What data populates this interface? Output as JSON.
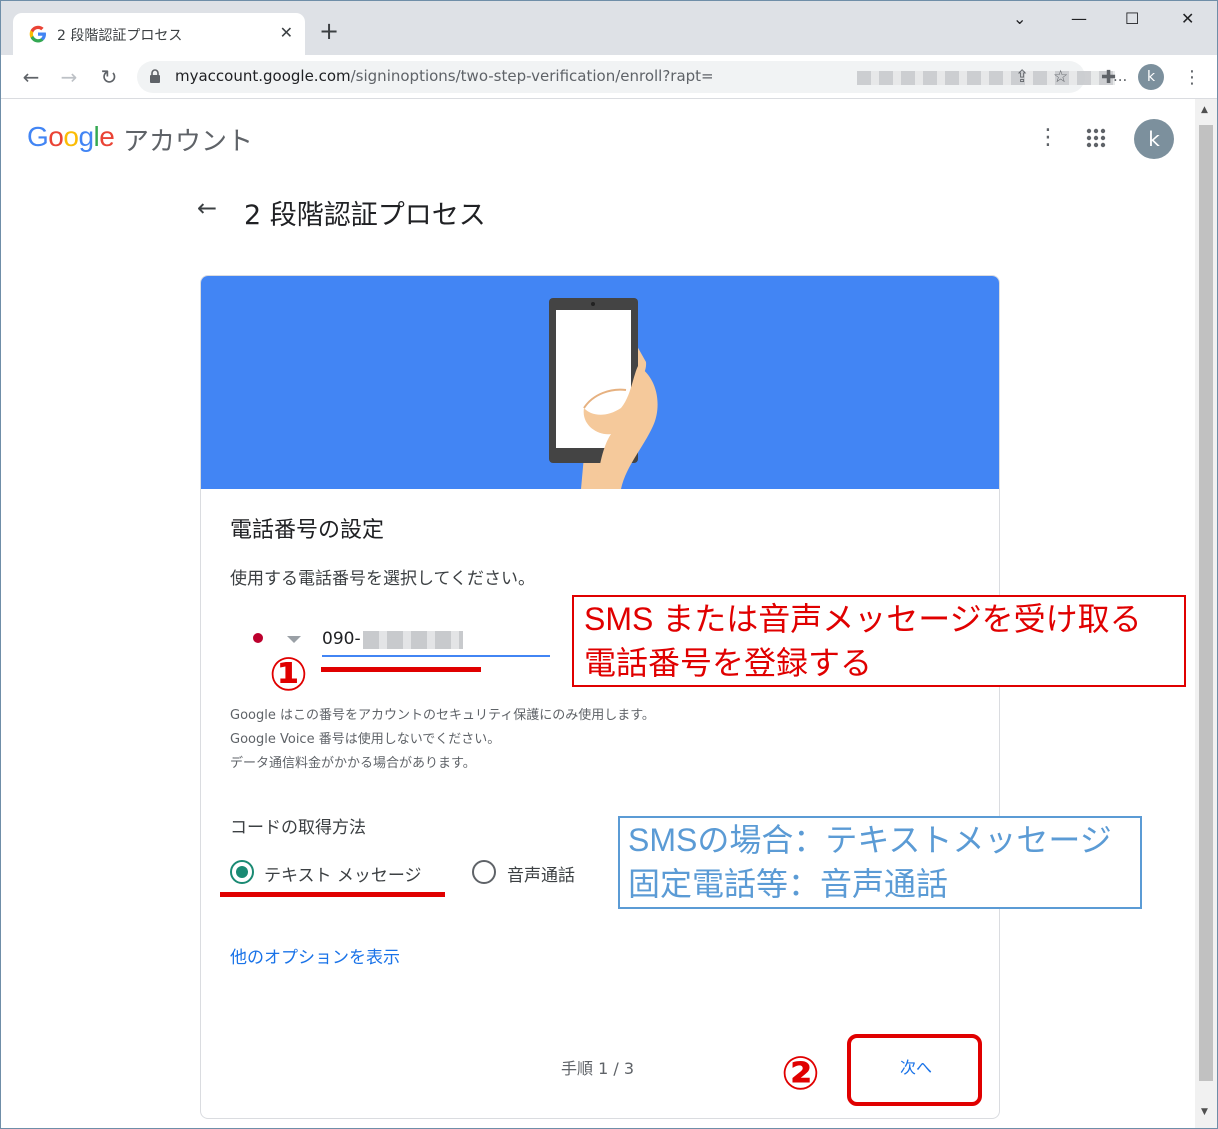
{
  "browser": {
    "tab_title": "2 段階認証プロセス",
    "tab_close": "✕",
    "new_tab": "+",
    "url_host": "myaccount.google.com",
    "url_path": "/signinoptions/two-step-verification/enroll?rapt=",
    "url_ellipsis": "...",
    "avatar_letter": "k",
    "controls": {
      "minimize": "—",
      "maximize": "☐",
      "close": "✕",
      "menu": "⌄"
    }
  },
  "header": {
    "logo_text": [
      "G",
      "o",
      "o",
      "g",
      "l",
      "e"
    ],
    "logo_colors": [
      "#4285f4",
      "#ea4335",
      "#fbbc05",
      "#4285f4",
      "#34a853",
      "#ea4335"
    ],
    "account_label": "アカウント",
    "avatar_letter": "k"
  },
  "page": {
    "title": "2 段階認証プロセス",
    "card": {
      "heading": "電話番号の設定",
      "instruction": "使用する電話番号を選択してください。",
      "phone_prefix": "090-",
      "help_lines": [
        "Google はこの番号をアカウントのセキュリティ保護にのみ使用します。",
        "Google Voice 番号は使用しないでください。",
        "データ通信料金がかかる場合があります。"
      ],
      "method_label": "コードの取得方法",
      "method_options": [
        {
          "label": "テキスト メッセージ",
          "selected": true
        },
        {
          "label": "音声通話",
          "selected": false
        }
      ],
      "more_options": "他のオプションを表示",
      "step": "手順 1 / 3",
      "next": "次へ"
    }
  },
  "annotations": {
    "marker1": "①",
    "marker2": "②",
    "red_note": [
      "SMS または音声メッセージを受け取る",
      "電話番号を登録する"
    ],
    "blue_note": [
      "SMSの場合：テキストメッセージ",
      "固定電話等：音声通話"
    ],
    "red_color": "#e00000",
    "blue_color": "#5b9bd5"
  },
  "colors": {
    "accent_blue": "#4285f4",
    "link_blue": "#1a73e8",
    "radio_green": "#1a8a73"
  }
}
